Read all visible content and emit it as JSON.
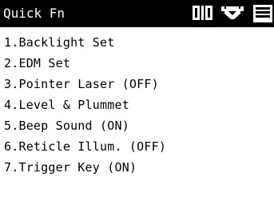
{
  "header": {
    "title": "Quick Fn",
    "icons": [
      "compensator-icon",
      "target-prism-icon",
      "battery-icon"
    ]
  },
  "menu": {
    "items": [
      {
        "label": "1.Backlight Set"
      },
      {
        "label": "2.EDM Set"
      },
      {
        "label": "3.Pointer Laser (OFF)"
      },
      {
        "label": "4.Level & Plummet"
      },
      {
        "label": "5.Beep Sound (ON)"
      },
      {
        "label": "6.Reticle Illum. (OFF)"
      },
      {
        "label": "7.Trigger Key (ON)"
      }
    ]
  },
  "colors": {
    "titlebar_bg": "#000000",
    "titlebar_fg": "#ffffff",
    "screen_bg": "#ffffff",
    "text": "#000000"
  }
}
